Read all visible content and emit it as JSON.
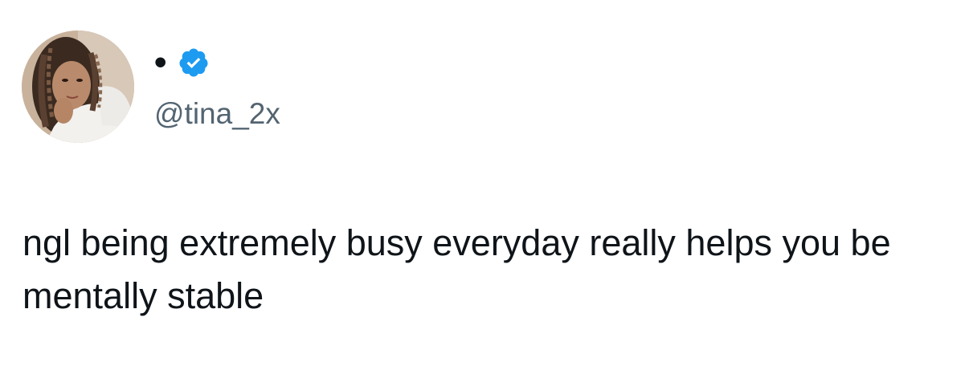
{
  "tweet": {
    "display_name": "•",
    "verified_icon": "verified-badge-icon",
    "handle": "@tina_2x",
    "text": "ngl being extremely busy everyday really helps you be mentally stable"
  },
  "colors": {
    "text": "#0f1419",
    "handle": "#536471",
    "verified": "#1d9bf0",
    "background": "#ffffff"
  }
}
